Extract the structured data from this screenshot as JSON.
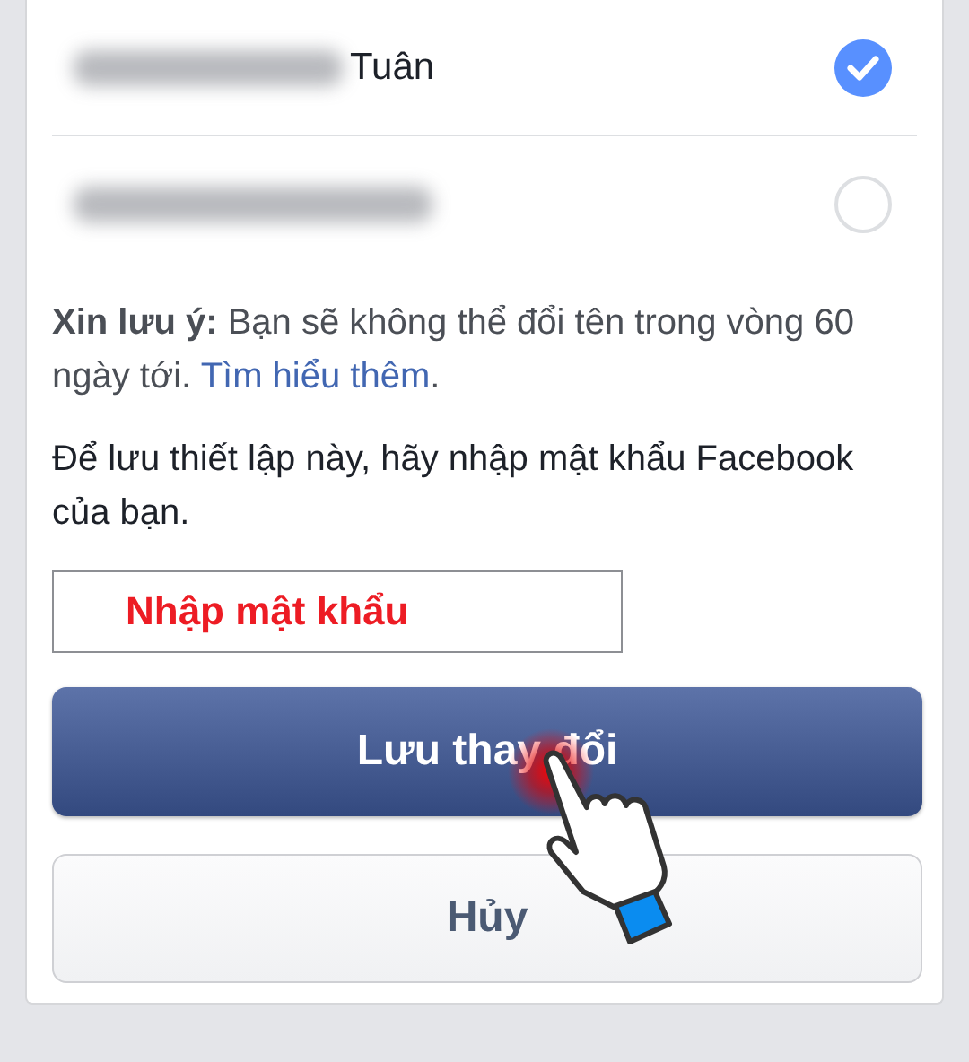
{
  "name_options": [
    {
      "visible_text": "Tuân",
      "selected": true
    },
    {
      "selected": false
    }
  ],
  "note": {
    "text": "**Xin lưu ý:** Bạn sẽ không thể đổi tên trong vòng 60 ngày tới.",
    "link": "Tìm hiểu thêm",
    "after": "."
  },
  "instruction": "Để lưu thiết lập này, hãy nhập mật khẩu Facebook của bạn.",
  "password_field": {
    "placeholder": "Nhập mật khẩu"
  },
  "buttons": [
    {
      "label": "Lưu thay đổi",
      "kind": "primary"
    },
    {
      "label": "Hủy",
      "kind": "secondary"
    }
  ]
}
